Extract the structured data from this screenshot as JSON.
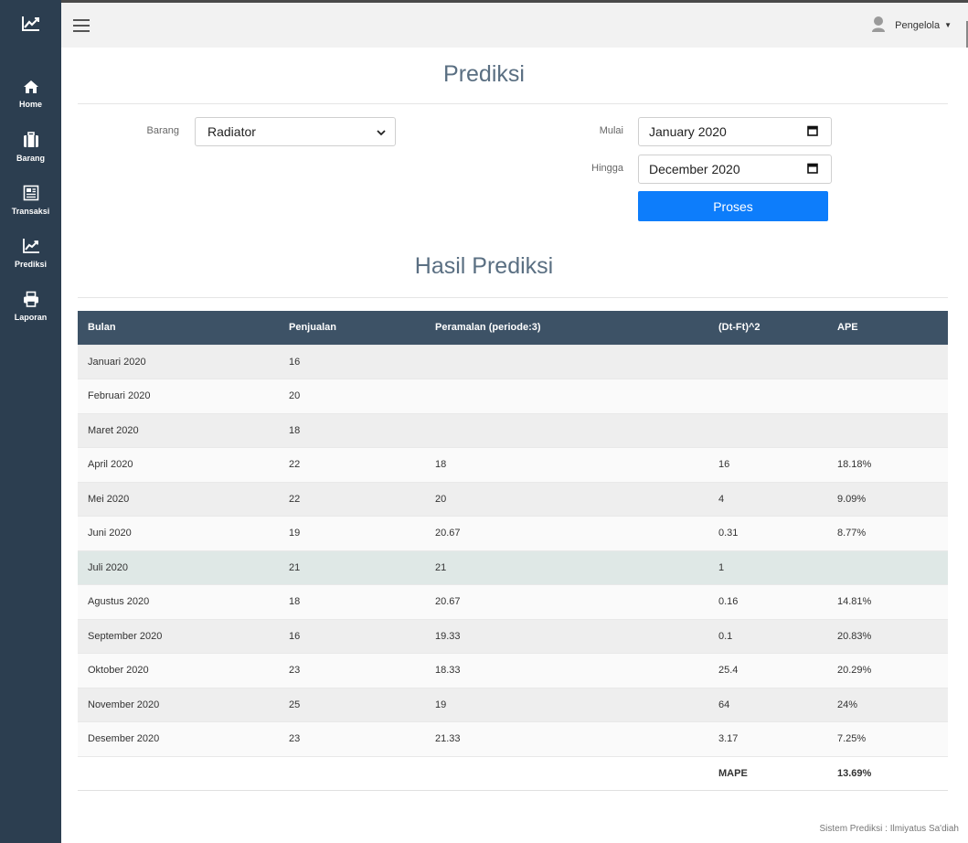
{
  "sidebar": {
    "items": [
      {
        "label": "Home",
        "icon": "home-icon"
      },
      {
        "label": "Barang",
        "icon": "briefcase-icon"
      },
      {
        "label": "Transaksi",
        "icon": "newspaper-icon"
      },
      {
        "label": "Prediksi",
        "icon": "chart-line-icon"
      },
      {
        "label": "Laporan",
        "icon": "printer-icon"
      }
    ]
  },
  "topbar": {
    "user_name": "Pengelola"
  },
  "page": {
    "title": "Prediksi",
    "result_title": "Hasil Prediksi"
  },
  "form": {
    "barang_label": "Barang",
    "barang_value": "Radiator",
    "mulai_label": "Mulai",
    "mulai_value": "January 2020",
    "hingga_label": "Hingga",
    "hingga_value": "December 2020",
    "proses_label": "Proses"
  },
  "table": {
    "headers": [
      "Bulan",
      "Penjualan",
      "Peramalan (periode:3)",
      "(Dt-Ft)^2",
      "APE"
    ],
    "rows": [
      [
        "Januari 2020",
        "16",
        "",
        "",
        ""
      ],
      [
        "Februari 2020",
        "20",
        "",
        "",
        ""
      ],
      [
        "Maret 2020",
        "18",
        "",
        "",
        ""
      ],
      [
        "April 2020",
        "22",
        "18",
        "16",
        "18.18%"
      ],
      [
        "Mei 2020",
        "22",
        "20",
        "4",
        "9.09%"
      ],
      [
        "Juni 2020",
        "19",
        "20.67",
        "0.31",
        "8.77%"
      ],
      [
        "Juli 2020",
        "21",
        "21",
        "1",
        ""
      ],
      [
        "Agustus 2020",
        "18",
        "20.67",
        "0.16",
        "14.81%"
      ],
      [
        "September 2020",
        "16",
        "19.33",
        "0.1",
        "20.83%"
      ],
      [
        "Oktober 2020",
        "23",
        "18.33",
        "25.4",
        "20.29%"
      ],
      [
        "November 2020",
        "25",
        "19",
        "64",
        "24%"
      ],
      [
        "Desember 2020",
        "23",
        "21.33",
        "3.17",
        "7.25%"
      ]
    ],
    "mape_label": "MAPE",
    "mape_value": "13.69%"
  },
  "footer": {
    "text": "Sistem Prediksi : Ilmiyatus Sa'diah"
  },
  "colors": {
    "sidebar": "#2c3e50",
    "table_header": "#3d5266",
    "primary_button": "#0d7dfb"
  }
}
